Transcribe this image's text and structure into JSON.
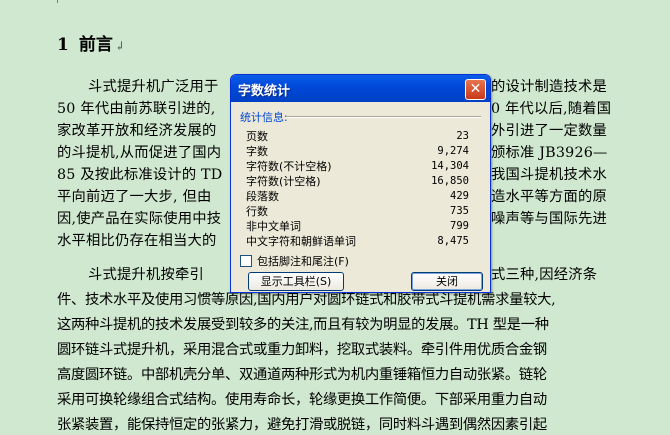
{
  "document": {
    "heading": {
      "number": "1",
      "title": "前言",
      "mark": "↲"
    },
    "lines": [
      "斗式提升机广泛用于",
      "的设计制造技术是",
      "50 年代由前苏联引进的,",
      "0 年代以后,随着国",
      "家改革开放和经济发展的",
      "外引进了一定数量",
      "的斗提机,从而促进了国内",
      "颁标准 JB3926—",
      "85 及按此标准设计的 TD",
      "我国斗提机技术水",
      "平向前迈了一大步, 但由",
      "造水平等方面的原",
      "因,使产品在实际使用中技",
      "噪声等与国际先进",
      "水平相比仍存在相当大的",
      "斗式提升机按牵引",
      "式三种,因经济条",
      "件、技术水平及使用习惯等原因,国内用户对圆环链式和胶带式斗提机需求量较大,",
      "这两种斗提机的技术发展受到较多的关注,而且有较为明显的发展。TH 型是一种",
      "圆环链斗式提升机，采用混合式或重力卸料，挖取式装料。牵引件用优质合金钢",
      "高度圆环链。中部机壳分单、双通道两种形式为机内重锤箱恒力自动张紧。链轮",
      "采用可换轮缘组合式结构。使用寿命长，轮缘更换工作简便。下部采用重力自动",
      "张紧装置，能保持恒定的张紧力，避免打滑或脱链，同时料斗遇到偶然因素引起"
    ]
  },
  "dialog": {
    "title": "字数统计",
    "close_glyph": "✕",
    "group_label": "统计信息:",
    "stats": [
      {
        "label": "页数",
        "value": "23"
      },
      {
        "label": "字数",
        "value": "9,274"
      },
      {
        "label": "字符数(不计空格)",
        "value": "14,304"
      },
      {
        "label": "字符数(计空格)",
        "value": "16,850"
      },
      {
        "label": "段落数",
        "value": "429"
      },
      {
        "label": "行数",
        "value": "735"
      },
      {
        "label": "非中文单词",
        "value": "799"
      },
      {
        "label": "中文字符和朝鲜语单词",
        "value": "8,475"
      }
    ],
    "checkbox_label": "包括脚注和尾注(F)",
    "show_toolbar_button": "显示工具栏(S)",
    "close_button": "关闭"
  }
}
